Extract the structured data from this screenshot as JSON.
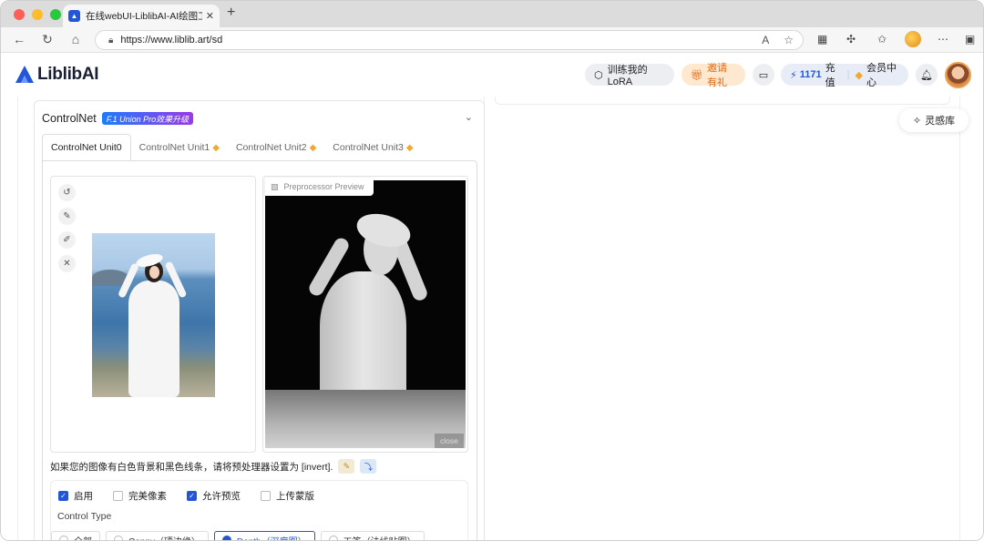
{
  "browser": {
    "tab_title": "在线webUI-LiblibAI-AI绘图工具",
    "tab_close": "✕",
    "new_tab": "+",
    "url": "https://www.liblib.art/sd"
  },
  "header": {
    "logo_text": "LiblibAI",
    "train_lora": "训练我的LoRA",
    "invite": "邀请有礼",
    "credits": "1171",
    "recharge": "充值",
    "member_center": "会员中心"
  },
  "inspiration": {
    "label": "灵感库"
  },
  "controlnet": {
    "title": "ControlNet",
    "badge": "F.1 Union Pro效果升级",
    "tabs": [
      {
        "label": "ControlNet Unit0"
      },
      {
        "label": "ControlNet Unit1"
      },
      {
        "label": "ControlNet Unit2"
      },
      {
        "label": "ControlNet Unit3"
      }
    ],
    "preview_label": "Preprocessor Preview",
    "close_label": "close",
    "invert_note": "如果您的图像有白色背景和黑色线条，请将预处理器设置为 [invert].",
    "checkboxes": [
      {
        "label": "启用",
        "checked": true
      },
      {
        "label": "完美像素",
        "checked": false
      },
      {
        "label": "允许预览",
        "checked": true
      },
      {
        "label": "上传蒙版",
        "checked": false
      }
    ],
    "control_type_label": "Control Type",
    "control_types": [
      {
        "label": "全部",
        "selected": false
      },
      {
        "label": "Canny（硬边缘）",
        "selected": false
      },
      {
        "label": "Depth（深度图）",
        "selected": true
      },
      {
        "label": "工签（法线贴图）",
        "selected": false
      }
    ]
  },
  "colors": {
    "accent": "#2355d8",
    "invite": "#e56a10",
    "badge_start": "#1e7bff",
    "badge_end": "#9a39e8"
  }
}
